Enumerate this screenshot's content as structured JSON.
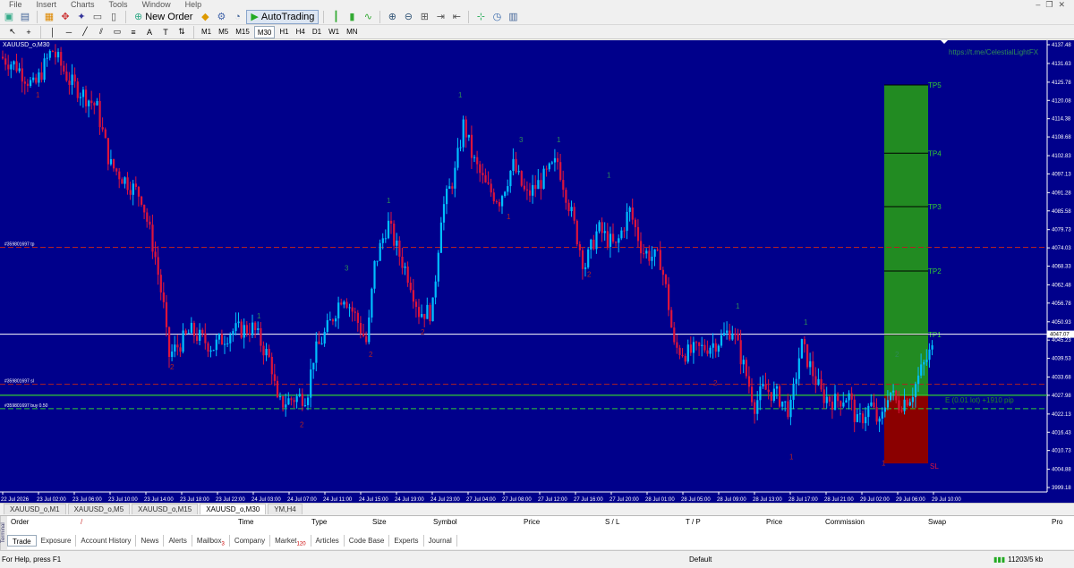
{
  "menu": {
    "items": [
      "File",
      "Insert",
      "Charts",
      "Tools",
      "Window",
      "Help"
    ]
  },
  "toolbar": {
    "new_order_label": "New Order",
    "autotrading_label": "AutoTrading"
  },
  "timeframes": [
    "M1",
    "M5",
    "M15",
    "M30",
    "H1",
    "H4",
    "D1",
    "W1",
    "MN"
  ],
  "timeframe_active": "M30",
  "chart": {
    "symbol_label": "XAUUSD_o,M30",
    "watermark": "https://t.me/CelestialLightFX",
    "current_price": "4047.07",
    "price_ticks": [
      "4137.48",
      "4131.63",
      "4125.78",
      "4120.08",
      "4114.38",
      "4108.68",
      "4102.83",
      "4097.13",
      "4091.28",
      "4085.58",
      "4079.73",
      "4074.03",
      "4068.33",
      "4062.48",
      "4056.78",
      "4050.93",
      "4045.23",
      "4039.53",
      "4033.68",
      "4027.98",
      "4022.13",
      "4016.43",
      "4010.73",
      "4004.88",
      "3999.18"
    ],
    "time_ticks": [
      "22 Jul 2026",
      "23 Jul 02:00",
      "23 Jul 06:00",
      "23 Jul 10:00",
      "23 Jul 14:00",
      "23 Jul 18:00",
      "23 Jul 22:00",
      "24 Jul 03:00",
      "24 Jul 07:00",
      "24 Jul 11:00",
      "24 Jul 15:00",
      "24 Jul 19:00",
      "24 Jul 23:00",
      "27 Jul 04:00",
      "27 Jul 08:00",
      "27 Jul 12:00",
      "27 Jul 16:00",
      "27 Jul 20:00",
      "28 Jul 01:00",
      "28 Jul 05:00",
      "28 Jul 09:00",
      "28 Jul 13:00",
      "28 Jul 17:00",
      "28 Jul 21:00",
      "29 Jul 02:00",
      "29 Jul 06:00",
      "29 Jul 10:00"
    ],
    "order_tp_label": "#359801697 tp",
    "order_sl_label": "#359801697 sl",
    "order_buy_label": "#359801697 buy 0.50",
    "tp_labels": [
      "TP5",
      "TP4",
      "TP3",
      "TP2",
      "TP1"
    ],
    "sl_label": "SL",
    "entry_label": "E (0.01 lot) +1910 pip",
    "wave_labels": [
      "1",
      "2",
      "1",
      "2",
      "3",
      "1",
      "2",
      "2",
      "1",
      "3",
      "1",
      "1",
      "1",
      "2",
      "1",
      "1",
      "2",
      "1",
      "2",
      "1"
    ],
    "colors": {
      "background": "#00008b",
      "bull": "#00bfff",
      "bear": "#dc143c",
      "tp_zone": "#228b22",
      "sl_zone": "#8b0000",
      "entry_line": "#32cd32",
      "current_line": "#ffffff"
    }
  },
  "chart_tabs": [
    "XAUUSD_o,M1",
    "XAUUSD_o,M5",
    "XAUUSD_o,M15",
    "XAUUSD_o,M30",
    "YM,H4"
  ],
  "chart_tab_active": "XAUUSD_o,M30",
  "terminal": {
    "side_label": "Terminal",
    "columns": [
      "Order",
      "/",
      "Time",
      "Type",
      "Size",
      "Symbol",
      "Price",
      "S / L",
      "T / P",
      "Price",
      "Commission",
      "Swap",
      "Pro"
    ],
    "tabs": [
      "Trade",
      "Exposure",
      "Account History",
      "News",
      "Alerts",
      "Mailbox",
      "Company",
      "Market",
      "Articles",
      "Code Base",
      "Experts",
      "Journal"
    ],
    "tab_badges": {
      "Mailbox": "3",
      "Market": "120"
    },
    "active_tab": "Trade"
  },
  "status": {
    "help": "For Help, press F1",
    "profile": "Default",
    "traffic": "11203/5 kb"
  }
}
